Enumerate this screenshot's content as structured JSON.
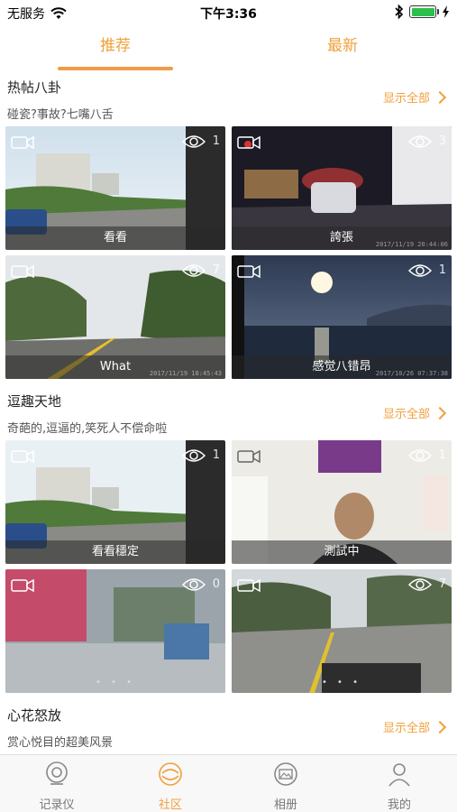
{
  "status_bar": {
    "carrier": "无服务",
    "time": "下午3:36"
  },
  "tabs": {
    "recommended": "推荐",
    "latest": "最新"
  },
  "sections": [
    {
      "title": "热帖八卦",
      "subtitle": "碰瓷?事故?七嘴八舌",
      "show_all": "显示全部",
      "videos": [
        {
          "caption": "看看",
          "views": "1",
          "stamp": ""
        },
        {
          "caption": "誇張",
          "views": "3",
          "stamp": "2017/11/19 20:44:06"
        },
        {
          "caption": "What",
          "views": "7",
          "stamp": "2017/11/19 18:45:43"
        },
        {
          "caption": "感觉八错昂",
          "views": "1",
          "stamp": "2017/10/26 07:37:38"
        }
      ]
    },
    {
      "title": "逗趣天地",
      "subtitle": "奇葩的,逗逼的,笑死人不偿命啦",
      "show_all": "显示全部",
      "videos": [
        {
          "caption": "看看穩定",
          "views": "1",
          "stamp": ""
        },
        {
          "caption": "測試中",
          "views": "1",
          "stamp": ""
        },
        {
          "caption": "",
          "views": "0",
          "stamp": ""
        },
        {
          "caption": "",
          "views": "7",
          "stamp": ""
        }
      ]
    },
    {
      "title": "心花怒放",
      "subtitle": "赏心悦目的超美风景",
      "show_all": "显示全部"
    }
  ],
  "bottom_nav": [
    {
      "label": "记录仪",
      "icon": "dashcam-icon"
    },
    {
      "label": "社区",
      "icon": "community-icon"
    },
    {
      "label": "相册",
      "icon": "album-icon"
    },
    {
      "label": "我的",
      "icon": "profile-icon"
    }
  ],
  "colors": {
    "accent": "#f0a03c",
    "nav_bg": "#f8f8f8"
  }
}
